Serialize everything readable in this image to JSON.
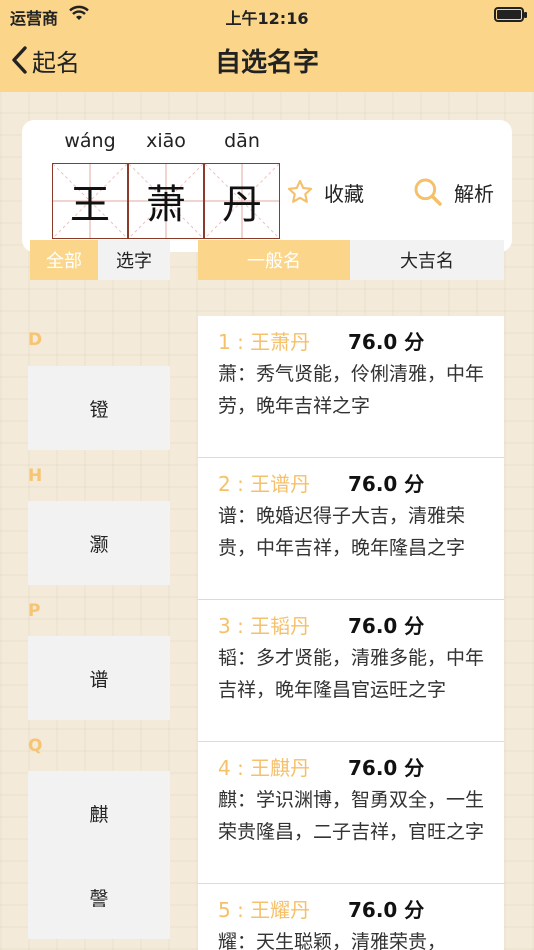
{
  "status": {
    "carrier": "运营商",
    "time": "上午12:16"
  },
  "nav": {
    "back_label": "起名",
    "title": "自选名字"
  },
  "name": {
    "pinyin": [
      "wáng",
      "xiāo",
      "dān"
    ],
    "chars": [
      "王",
      "萧",
      "丹"
    ]
  },
  "actions": {
    "favorite_label": "收藏",
    "analyze_label": "解析"
  },
  "tabs": {
    "left": [
      "全部",
      "选字"
    ],
    "right": [
      "一般名",
      "大吉名"
    ]
  },
  "left_list": [
    {
      "letter": "D",
      "chars": [
        "镫"
      ]
    },
    {
      "letter": "H",
      "chars": [
        "灏"
      ]
    },
    {
      "letter": "P",
      "chars": [
        "谱"
      ]
    },
    {
      "letter": "Q",
      "chars": [
        "麒",
        "謦"
      ]
    }
  ],
  "results": [
    {
      "title": "1 : 王萧丹",
      "score": "76.0 分",
      "desc": "萧：秀气贤能，伶俐清雅，中年劳，晚年吉祥之字"
    },
    {
      "title": "2 : 王谱丹",
      "score": "76.0 分",
      "desc": "谱：晚婚迟得子大吉，清雅荣贵，中年吉祥，晚年隆昌之字"
    },
    {
      "title": "3 : 王韬丹",
      "score": "76.0 分",
      "desc": "韬：多才贤能，清雅多能，中年吉祥，晚年隆昌官运旺之字"
    },
    {
      "title": "4 : 王麒丹",
      "score": "76.0 分",
      "desc": "麒：学识渊博，智勇双全，一生荣贵隆昌，二子吉祥，官旺之字"
    },
    {
      "title": "5 : 王耀丹",
      "score": "76.0 分",
      "desc": "耀：天生聪颖，清雅荣贵，"
    }
  ],
  "colors": {
    "accent": "#fbd68a",
    "accent_text": "#f5c06a",
    "box_border": "#8c3a2a"
  }
}
